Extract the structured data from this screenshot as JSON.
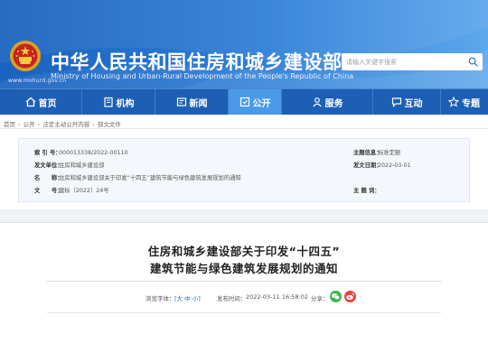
{
  "header": {
    "title": "中华人民共和国住房和城乡建设部",
    "subtitle": "Ministry of Housing and Urban-Rural Development of the People's Republic of China",
    "url": "www.mohurd.gov.cn",
    "search_placeholder": "请输入关键字搜索"
  },
  "nav": {
    "items": [
      {
        "label": "首页",
        "icon": "home-icon"
      },
      {
        "label": "机构",
        "icon": "building-icon"
      },
      {
        "label": "新闻",
        "icon": "news-icon"
      },
      {
        "label": "公开",
        "icon": "disclosure-icon",
        "active": true
      },
      {
        "label": "服务",
        "icon": "service-icon"
      },
      {
        "label": "互动",
        "icon": "chat-icon"
      },
      {
        "label": "专题",
        "icon": "topic-icon"
      }
    ]
  },
  "breadcrumb": [
    "首页",
    "公开",
    "法定主动公开内容",
    "部文文件"
  ],
  "info": {
    "index_label": "索 引 号：",
    "index_value": "000013338/2022-00110",
    "theme_label": "主题信息：",
    "theme_value": "标准定额",
    "issuer_label": "发文单位：",
    "issuer_value": "住房和城乡建设部",
    "date_label": "发文日期：",
    "date_value": "2022-03-01",
    "name_label": "名　　称：",
    "name_value": "住房和城乡建设部关于印发“十四五”建筑节能与绿色建筑发展规划的通知",
    "docno_label": "文　　号：",
    "docno_value": "建标〔2022〕24号",
    "keywords_label": "主 题 词："
  },
  "article": {
    "title_line1": "住房和城乡建设部关于印发“十四五”",
    "title_line2": "建筑节能与绿色建筑发展规划的通知",
    "font_label": "浏览字体：",
    "font_sizes": [
      "大",
      "中",
      "小"
    ],
    "publish_label": "发布时间：",
    "publish_time": "2022-03-11 16:58:02",
    "share_label": "分享："
  },
  "colors": {
    "header_blue": "#1a62bf",
    "nav_blue": "#1d5fb4",
    "nav_active": "#4b9ae8",
    "link_blue": "#2a6cc6"
  }
}
